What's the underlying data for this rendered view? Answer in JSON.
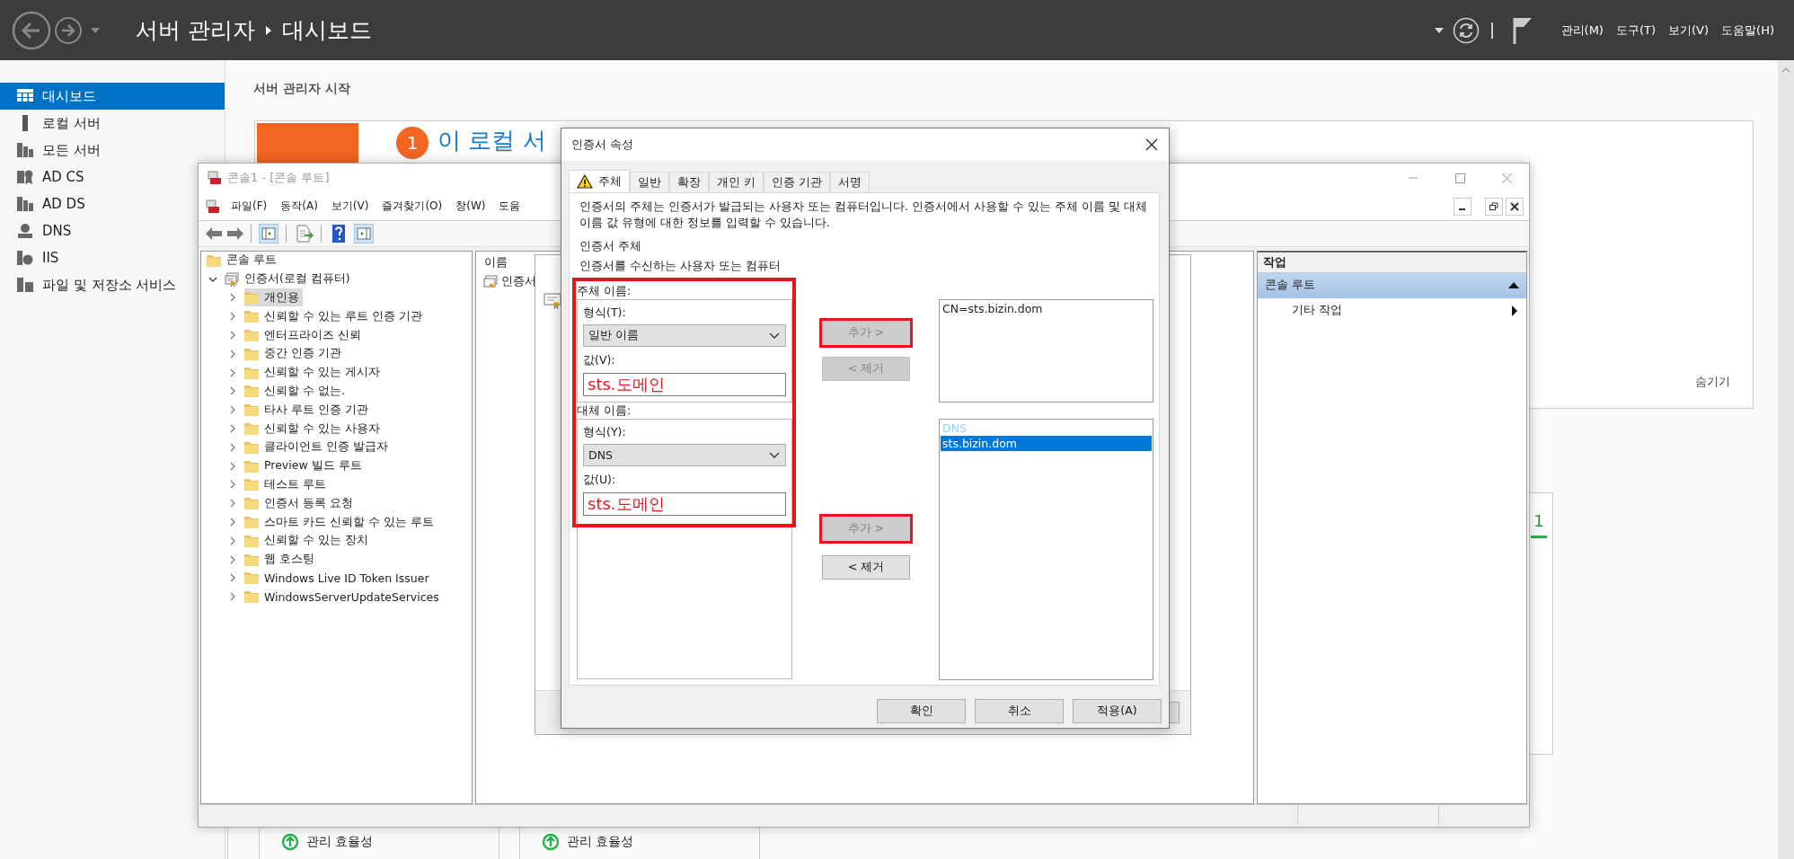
{
  "header": {
    "breadcrumb": [
      "서버 관리자",
      "대시보드"
    ],
    "menu": [
      "관리(M)",
      "도구(T)",
      "보기(V)",
      "도움말(H)"
    ]
  },
  "sidebar": {
    "items": [
      {
        "label": "대시보드",
        "selected": true
      },
      {
        "label": "로컬 서버",
        "selected": false
      },
      {
        "label": "모든 서버",
        "selected": false
      },
      {
        "label": "AD CS",
        "selected": false
      },
      {
        "label": "AD DS",
        "selected": false
      },
      {
        "label": "DNS",
        "selected": false
      },
      {
        "label": "IIS",
        "selected": false
      },
      {
        "label": "파일 및 저장소 서비스",
        "selected": false
      }
    ]
  },
  "dashboard": {
    "heading": "서버 관리자 시작",
    "welcome": {
      "step": "1",
      "title": "이 로컬 서",
      "hide_link": "숨기기"
    },
    "role_card": {
      "count": "1"
    },
    "tiles": [
      {
        "label": "관리 효율성"
      },
      {
        "label": "관리 효율성"
      }
    ]
  },
  "console": {
    "title": "콘솔1 - [콘솔 루트]",
    "menu": [
      "파일(F)",
      "동작(A)",
      "보기(V)",
      "즐겨찾기(O)",
      "창(W)",
      "도움"
    ],
    "tree": [
      {
        "label": "콘솔 루트",
        "children": [
          {
            "label": "인증서(로컬 컴퓨터)",
            "expanded": true,
            "children": [
              {
                "label": "개인용",
                "selected": true,
                "expanded": false
              },
              {
                "label": "신뢰할 수 있는 루트 인증 기관",
                "selected": false,
                "expanded": false
              },
              {
                "label": "엔터프라이즈 신뢰",
                "selected": false,
                "expanded": false
              },
              {
                "label": "중간 인증 기관",
                "selected": false,
                "expanded": false
              },
              {
                "label": "신뢰할 수 있는 게시자",
                "selected": false,
                "expanded": false
              },
              {
                "label": "신뢰할 수 없는.",
                "selected": false,
                "expanded": false
              },
              {
                "label": "타사 루트 인증 기관",
                "selected": false,
                "expanded": false
              },
              {
                "label": "신뢰할 수 있는 사용자",
                "selected": false,
                "expanded": false
              },
              {
                "label": "클라이언트 인증 발급자",
                "selected": false,
                "expanded": false
              },
              {
                "label": "Preview 빌드 루트",
                "selected": false,
                "expanded": false
              },
              {
                "label": "테스트 루트",
                "selected": false,
                "expanded": false
              },
              {
                "label": "인증서 등록 요청",
                "selected": false,
                "expanded": false
              },
              {
                "label": "스마트 카드 신뢰할 수 있는 루트",
                "selected": false,
                "expanded": false
              },
              {
                "label": "신뢰할 수 있는 장치",
                "selected": false,
                "expanded": false
              },
              {
                "label": "웹 호스팅",
                "selected": false,
                "expanded": false
              },
              {
                "label": "Windows Live ID Token Issuer",
                "selected": false,
                "expanded": false
              },
              {
                "label": "WindowsServerUpdateServices",
                "selected": false,
                "expanded": false
              }
            ]
          }
        ]
      }
    ],
    "list": {
      "column": "이름",
      "items": [
        "인증서"
      ]
    },
    "actions": {
      "title": "작업",
      "section": "콘솔 루트",
      "items": [
        "기타 작업"
      ]
    }
  },
  "dialog": {
    "title": "인증서 속성",
    "tabs": [
      {
        "label": "주체",
        "selected": true,
        "warning": true
      },
      {
        "label": "일반",
        "selected": false,
        "warning": false
      },
      {
        "label": "확장",
        "selected": false,
        "warning": false
      },
      {
        "label": "개인 키",
        "selected": false,
        "warning": false
      },
      {
        "label": "인증 기관",
        "selected": false,
        "warning": false
      },
      {
        "label": "서명",
        "selected": false,
        "warning": false
      }
    ],
    "description": "인증서의 주체는 인증서가 발급되는 사용자 또는 컴퓨터입니다. 인증서에서 사용할 수 있는 주체 이름 및 대체 이름 값 유형에 대한 정보를 입력할 수 있습니다.",
    "heading": "인증서 주체",
    "subheading": "인증서를 수신하는 사용자 또는 컴퓨터",
    "highlighted": true,
    "subject_name": {
      "label": "주체 이름:",
      "type_label": "형식(T):",
      "type": "일반 이름",
      "value_label": "값(V):",
      "value": "sts.도메인"
    },
    "alt_name": {
      "label": "대체 이름:",
      "type_label": "형식(Y):",
      "type": "DNS",
      "value_label": "값(U):",
      "value": "sts.도메인"
    },
    "subject_buttons": [
      {
        "label": "추가 >",
        "disabled": true,
        "highlighted": true
      },
      {
        "label": "< 제거",
        "disabled": true,
        "highlighted": false
      }
    ],
    "alt_buttons": [
      {
        "label": "추가 >",
        "disabled": true,
        "highlighted": true
      },
      {
        "label": "< 제거",
        "disabled": false,
        "highlighted": false
      }
    ],
    "subject_list": [
      "CN=sts.bizin.dom"
    ],
    "alt_list": {
      "group": "DNS",
      "items": [
        {
          "label": "sts.bizin.dom",
          "selected": true
        }
      ]
    },
    "footer": [
      "확인",
      "취소",
      "적용(A)"
    ]
  }
}
